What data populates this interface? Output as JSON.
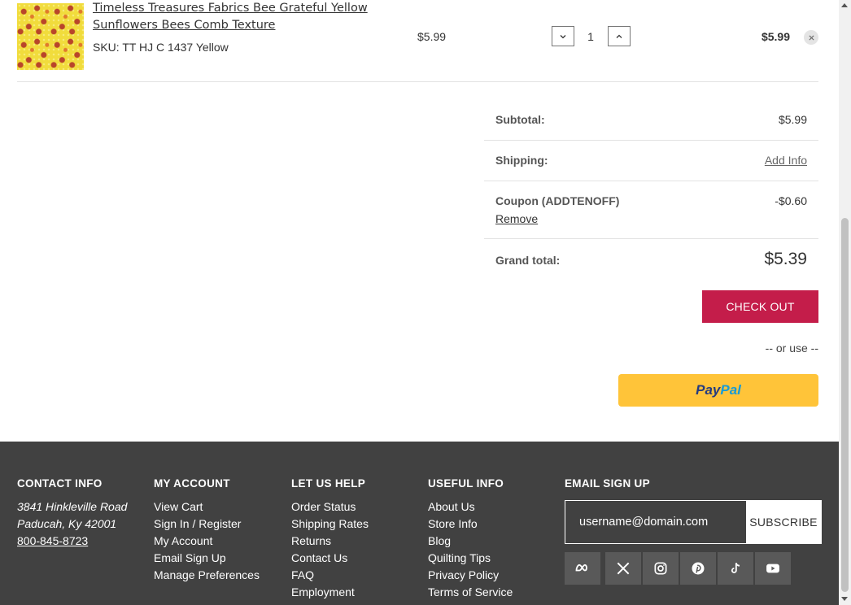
{
  "cart_item": {
    "title": "Timeless Treasures Fabrics Bee Grateful Yellow Sunflowers Bees Comb Texture",
    "sku": "SKU: TT HJ C 1437 Yellow",
    "price": "$5.99",
    "quantity": "1",
    "line_total": "$5.99"
  },
  "totals": {
    "subtotal_label": "Subtotal:",
    "subtotal_value": "$5.99",
    "shipping_label": "Shipping:",
    "shipping_value": "Add Info",
    "coupon_label": "Coupon (ADDTENOFF)",
    "coupon_remove": "Remove",
    "coupon_value": "-$0.60",
    "grand_label": "Grand total:",
    "grand_value": "$5.39"
  },
  "checkout_label": "CHECK OUT",
  "or_use_text": "-- or use --",
  "paypal": {
    "pay": "Pay",
    "pal": "Pal"
  },
  "footer": {
    "contact": {
      "heading": "CONTACT INFO",
      "address1": "3841 Hinkleville Road",
      "address2": "Paducah, Ky 42001",
      "phone": "800-845-8723"
    },
    "my_account": {
      "heading": "MY ACCOUNT",
      "links": [
        "View Cart",
        "Sign In / Register",
        "My Account",
        "Email Sign Up",
        "Manage Preferences"
      ]
    },
    "let_us_help": {
      "heading": "LET US HELP",
      "links": [
        "Order Status",
        "Shipping Rates",
        "Returns",
        "Contact Us",
        "FAQ",
        "Employment"
      ]
    },
    "useful_info": {
      "heading": "USEFUL INFO",
      "links": [
        "About Us",
        "Store Info",
        "Blog",
        "Quilting Tips",
        "Privacy Policy",
        "Terms of Service"
      ]
    },
    "email_signup": {
      "heading": "EMAIL SIGN UP",
      "input_value": "username@domain.com",
      "subscribe_label": "SUBSCRIBE"
    },
    "socials": [
      "meta-icon",
      "x-icon",
      "instagram-icon",
      "pinterest-icon",
      "tiktok-icon",
      "youtube-icon"
    ]
  },
  "colors": {
    "checkout": "#c41d4a",
    "paypal": "#ffc439",
    "footer_bg": "#414141"
  }
}
